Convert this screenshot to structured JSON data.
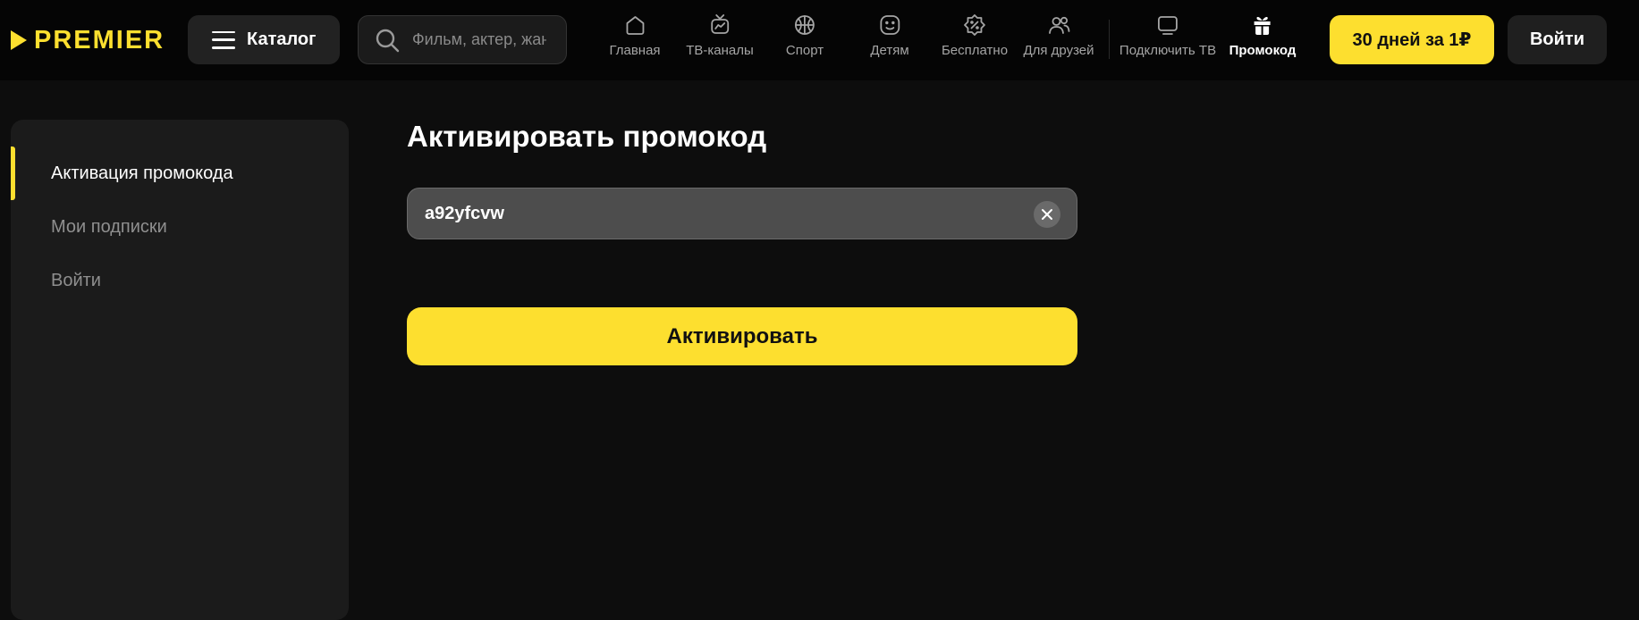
{
  "header": {
    "logo_text": "PREMIER",
    "catalog_label": "Каталог",
    "search_placeholder": "Фильм, актер, жанр",
    "nav": [
      {
        "label": "Главная",
        "icon": "home-icon"
      },
      {
        "label": "ТВ-каналы",
        "icon": "tv-channels-icon"
      },
      {
        "label": "Спорт",
        "icon": "basketball-icon"
      },
      {
        "label": "Детям",
        "icon": "smile-icon"
      },
      {
        "label": "Бесплатно",
        "icon": "percent-badge-icon"
      },
      {
        "label": "Для друзей",
        "icon": "friends-icon"
      },
      {
        "label": "Подключить ТВ",
        "icon": "monitor-icon"
      },
      {
        "label": "Промокод",
        "icon": "gift-icon",
        "active": true
      }
    ],
    "promo_button": "30 дней за 1₽",
    "login_button": "Войти"
  },
  "sidebar": {
    "items": [
      {
        "label": "Активация промокода",
        "active": true
      },
      {
        "label": "Мои подписки"
      },
      {
        "label": "Войти"
      }
    ]
  },
  "main": {
    "title": "Активировать промокод",
    "code_value": "a92yfcvw",
    "activate_button": "Активировать"
  },
  "colors": {
    "accent": "#fddf2f",
    "background": "#0d0d0d",
    "sidebar": "#1b1b1b"
  }
}
